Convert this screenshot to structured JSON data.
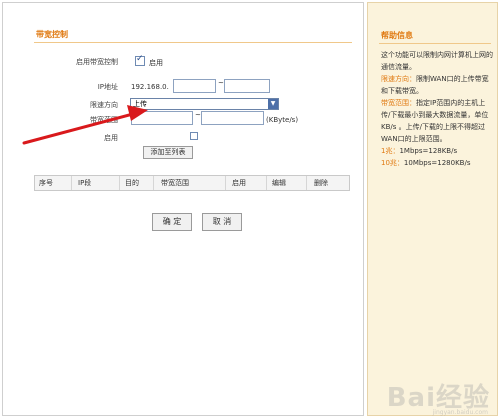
{
  "section": {
    "title": "带宽控制"
  },
  "form": {
    "enable_bandwidth_label": "启用带宽控制",
    "enable_bandwidth_text": "启用",
    "ip_label": "IP地址",
    "ip_prefix": "192.168.0.",
    "ip_separator": "~",
    "limit_direction_label": "限速方向",
    "limit_direction_value": "上传",
    "bandwidth_range_label": "带宽范围",
    "bandwidth_separator": "~",
    "bandwidth_unit": "(KByte/s)",
    "enable_label": "启用",
    "add_to_list_button": "添加至列表"
  },
  "table": {
    "headers": [
      "序号",
      "IP段",
      "目的",
      "带宽范围",
      "启用",
      "编辑",
      "删除"
    ]
  },
  "actions": {
    "ok_button": "确 定",
    "cancel_button": "取 消"
  },
  "help": {
    "title": "帮助信息",
    "intro": "这个功能可以限制内网计算机上网的通信流量。",
    "dir_label": "限速方向：",
    "dir_text": "限制WAN口的上传带宽和下载带宽。",
    "range_label": "带宽范围：",
    "range_text": "指定IP范围内的主机上传/下载最小到最大数据流量，单位KB/s 。上传/下载的上限不得超过WAN口的上限范围。",
    "ex1_label": "1兆：",
    "ex1_text": "1Mbps=128KB/s",
    "ex2_label": "10兆：",
    "ex2_text": "10Mbps=1280KB/s"
  },
  "watermark": {
    "text": "Bai经验",
    "sub": "jingyan.baidu.com"
  },
  "colors": {
    "accent": "#e07a12",
    "arrow": "#d9191c",
    "help_bg": "#fbf3dc"
  }
}
